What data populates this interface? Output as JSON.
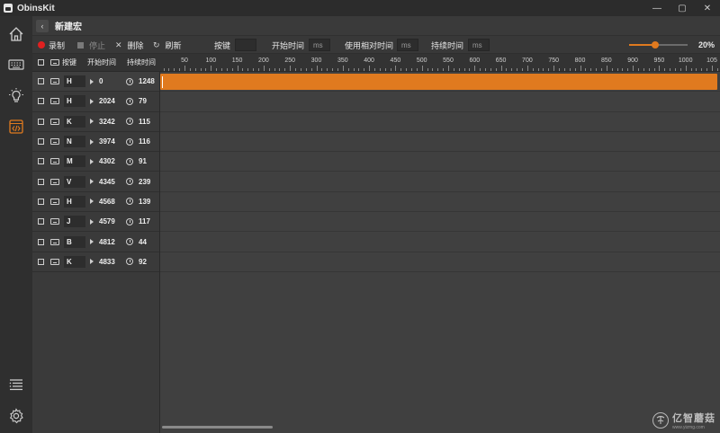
{
  "app": {
    "title": "ObinsKit",
    "window_controls": [
      "—",
      "▢",
      "✕"
    ]
  },
  "rail": {
    "items": [
      {
        "icon": "home-icon"
      },
      {
        "icon": "keyboard-icon"
      },
      {
        "icon": "lightbulb-icon"
      },
      {
        "icon": "macro-code-icon",
        "active": true
      },
      {
        "icon": "list-icon"
      },
      {
        "icon": "gear-icon"
      }
    ]
  },
  "header": {
    "back_icon": "‹",
    "title": "新建宏"
  },
  "toolbar": {
    "record_label": "录制",
    "stop_label": "停止",
    "delete_label": "删除",
    "refresh_label": "刷新",
    "key_label": "按键",
    "start_time_label": "开始时间",
    "start_unit": "ms",
    "relative_time_label": "使用相对时间",
    "relative_unit": "ms",
    "duration_label": "持续时间",
    "duration_unit": "ms",
    "zoom_fraction": 0.2,
    "zoom_label": "20%",
    "accent": "#e07a1f",
    "record_color": "#e02020"
  },
  "list_header": {
    "key": "按键",
    "start_time": "开始时间",
    "duration": "持续时间"
  },
  "ruler": {
    "ticks": [
      "50",
      "100",
      "150",
      "200",
      "250",
      "300",
      "350",
      "400",
      "450",
      "500",
      "550",
      "600",
      "650",
      "700",
      "750",
      "800",
      "850",
      "900",
      "950",
      "1000",
      "105"
    ]
  },
  "rows": [
    {
      "key": "H",
      "start": "0",
      "duration": "1248"
    },
    {
      "key": "H",
      "start": "2024",
      "duration": "79"
    },
    {
      "key": "K",
      "start": "3242",
      "duration": "115"
    },
    {
      "key": "N",
      "start": "3974",
      "duration": "116"
    },
    {
      "key": "M",
      "start": "4302",
      "duration": "91"
    },
    {
      "key": "V",
      "start": "4345",
      "duration": "239"
    },
    {
      "key": "H",
      "start": "4568",
      "duration": "139"
    },
    {
      "key": "J",
      "start": "4579",
      "duration": "117"
    },
    {
      "key": "B",
      "start": "4812",
      "duration": "44"
    },
    {
      "key": "K",
      "start": "4833",
      "duration": "92"
    }
  ],
  "watermark": {
    "brand": "亿智蘑菇",
    "url": "www.yizmg.com"
  }
}
